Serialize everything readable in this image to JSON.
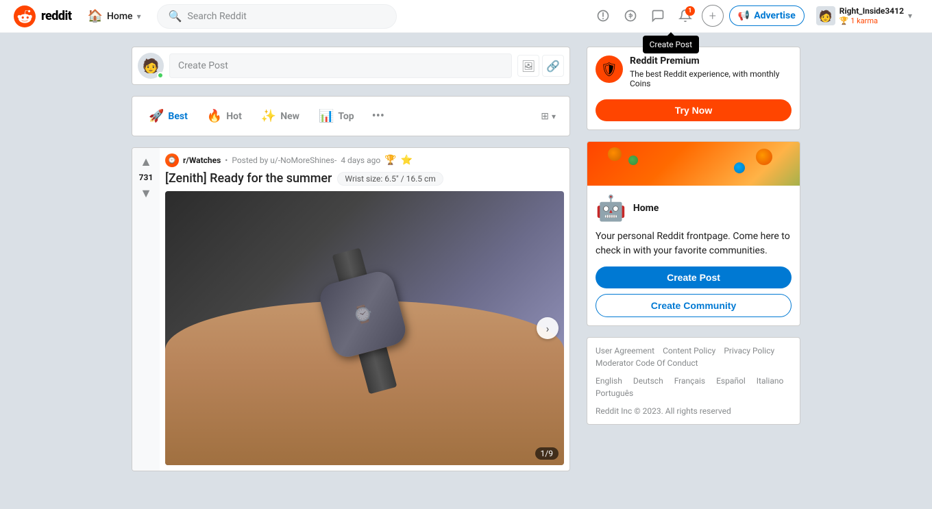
{
  "header": {
    "logo_text": "reddit",
    "home_label": "Home",
    "search_placeholder": "Search Reddit",
    "advertise_label": "Advertise",
    "user_name": "Right_Inside3412",
    "user_karma": "1 karma",
    "create_post_tooltip": "Create Post"
  },
  "sort_tabs": {
    "best_label": "Best",
    "hot_label": "Hot",
    "new_label": "New",
    "top_label": "Top",
    "more_icon": "•••"
  },
  "create_post_box": {
    "placeholder": "Create Post"
  },
  "post": {
    "subreddit": "r/Watches",
    "posted_by": "Posted by u/-NoMoreShines-",
    "time": "4 days ago",
    "title": "[Zenith] Ready for the summer",
    "flair": "Wrist size: 6.5\" / 16.5 cm",
    "vote_count": "731",
    "image_counter": "1/9"
  },
  "sidebar": {
    "premium": {
      "title": "Reddit Premium",
      "description": "The best Reddit experience, with monthly Coins",
      "try_now": "Try Now"
    },
    "home": {
      "title": "Home",
      "description": "Your personal Reddit frontpage. Come here to check in with your favorite communities.",
      "create_post_label": "Create Post",
      "create_community_label": "Create Community"
    },
    "footer": {
      "links": [
        "User Agreement",
        "Content Policy",
        "Privacy Policy",
        "Moderator Code Of Conduct"
      ],
      "languages": [
        "English",
        "Deutsch",
        "Français",
        "Español",
        "Italiano",
        "Português"
      ],
      "copyright": "Reddit Inc © 2023. All rights reserved"
    }
  }
}
